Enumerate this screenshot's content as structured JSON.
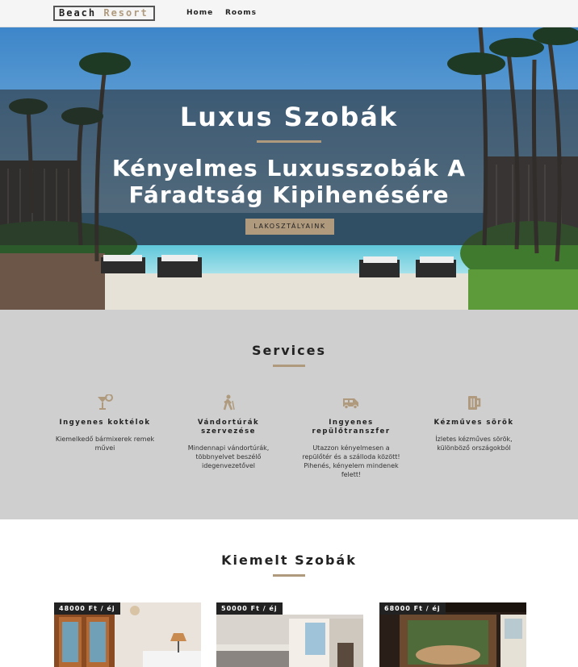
{
  "nav": {
    "logo_word1": "Beach",
    "logo_word2": "Resort",
    "links": [
      "Home",
      "Rooms"
    ]
  },
  "hero": {
    "title": "Luxus Szobák",
    "subtitle": "Kényelmes Luxusszobák A Fáradtság Kipihenésére",
    "button_label": "LAKOSZTÁLYAINK"
  },
  "services": {
    "title": "Services",
    "items": [
      {
        "icon": "cocktail-icon",
        "title": "Ingyenes koktélok",
        "text": "Kiemelkedő bármixerek remek művei"
      },
      {
        "icon": "hiking-icon",
        "title": "Vándortúrák szervezése",
        "text": "Mindennapi vándortúrák, többnyelvet beszélő idegenvezetővel"
      },
      {
        "icon": "shuttle-van-icon",
        "title": "Ingyenes repülőtranszfer",
        "text": "Utazzon kényelmesen a repülőtér és a szálloda között! Pihenés, kényelem mindenek felett!"
      },
      {
        "icon": "beer-icon",
        "title": "Kézműves sörök",
        "text": "Ízletes kézműves sörök, különböző országokból"
      }
    ]
  },
  "featured": {
    "title": "Kiemelt Szobák",
    "rooms": [
      {
        "price": "48000 Ft / éj"
      },
      {
        "price": "50000 Ft / éj"
      },
      {
        "price": "68000 Ft / éj"
      }
    ]
  },
  "colors": {
    "accent": "#af9a7d",
    "services_bg": "#cfcfcf",
    "nav_bg": "#f5f5f5"
  }
}
